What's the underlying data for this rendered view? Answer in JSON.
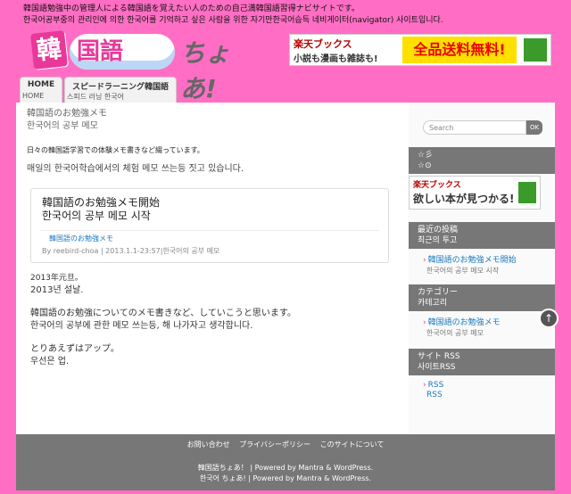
{
  "header": {
    "tagline1": "韓国語勉強中の管理人による韓国語を覚えたい人のための自己満韓国語習得ナビサイトです。",
    "tagline2": "한국어공부중의 관리인에 의한 한국어를 기억하고 싶은 사람을 위한 자기만한국어습득 네비게이터(navigator) 사이트입니다.",
    "logo": {
      "kanji": "韓",
      "word": "国語",
      "choa": "ちょあ!"
    },
    "banner": {
      "brand": "楽天ブックス",
      "slogan": "小説も漫画も雑誌も!",
      "promo": "全品送料無料!"
    }
  },
  "nav": {
    "tabs": [
      {
        "label": "HOME",
        "sub": "HOME"
      },
      {
        "label": "スピードラーニング韓国語",
        "sub": "스피드 러닝 한국어"
      }
    ]
  },
  "main": {
    "category_jp": "韓国語のお勉強メモ",
    "category_kr": "한국어의 공부 메모",
    "desc_jp": "日々の韓国語学習での体験メモ書きなど綴っています。",
    "desc_kr": "매일의 한국어학습에서의 체험 메모 쓰는등 짓고 있습니다.",
    "post": {
      "title_jp": "韓国語のお勉強メモ開始",
      "title_kr": "한국어의 공부 메모 시작",
      "category_link": "韓国語のお勉強メモ",
      "meta": "By reebird-choa | 2013.1.1-23:57|한국어의 공부 메모"
    },
    "body": [
      "2013年元旦。",
      "2013년 설날.",
      "",
      "韓国語のお勉強についてのメモ書きなど、していこうと思います。",
      "한국어의 공부에 관한 메모 쓰는등, 해 나가자고 생각합니다.",
      "",
      "とりあえずはアップ。",
      "우선은 업."
    ]
  },
  "sidebar": {
    "search_placeholder": "Search",
    "search_button": "OK",
    "widget1_title1": "☆彡",
    "widget1_title2": "☆⊙",
    "rakuten_brand": "楽天ブックス",
    "rakuten_text": "欲しい本が見つかる!",
    "recent_title1": "最近の投稿",
    "recent_title2": "최근의 투고",
    "recent_link": "韓国語のお勉強メモ開始",
    "recent_sub": "한국어의 공부 메모 시작",
    "cat_title1": "カテゴリー",
    "cat_title2": "카테고리",
    "cat_link": "韓国語のお勉強メモ",
    "cat_sub": "한국어의 공부 메모",
    "rss_title1": "サイト RSS",
    "rss_title2": "사이트RSS",
    "rss_link1": "RSS",
    "rss_link2": "RSS"
  },
  "footer": {
    "links": [
      "お問い合わせ",
      "プライバシーポリシー",
      "このサイトについて"
    ],
    "copyright1": "韓国語ちょあ！ | Powered by Mantra & WordPress.",
    "copyright2": "한국어 ちょあ! | Powered by Mantra & WordPress."
  },
  "colors": {
    "background": "#ff6ec4",
    "accent": "#e8389a",
    "link": "#1a7abf",
    "widget": "#777777"
  }
}
